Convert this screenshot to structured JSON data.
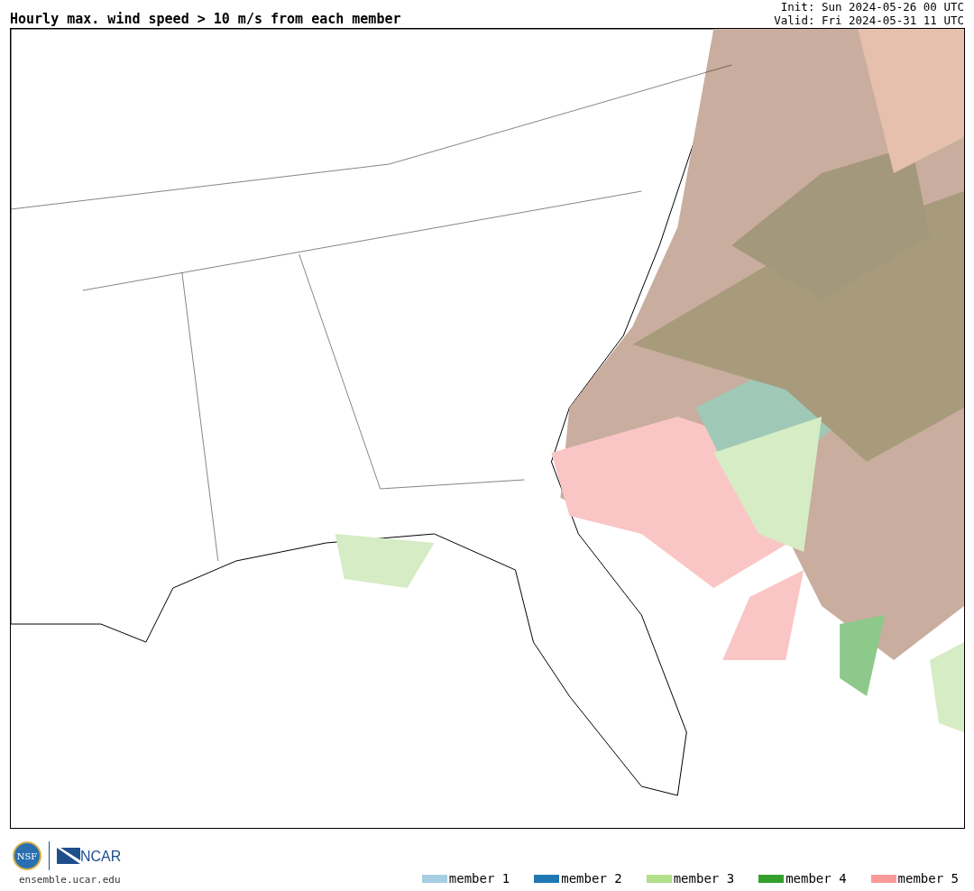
{
  "title": "Hourly max. wind speed > 10 m/s from each member",
  "init": "Init: Sun 2024-05-26 00 UTC",
  "valid": "Valid: Fri 2024-05-31 11 UTC",
  "logos": {
    "nsf": "NSF",
    "ncar": "NCAR"
  },
  "site": "ensemble.ucar.edu",
  "legend": [
    {
      "label": "member 1",
      "color": "#a6cee3"
    },
    {
      "label": "member 2",
      "color": "#1f78b4"
    },
    {
      "label": "member 3",
      "color": "#b2df8a"
    },
    {
      "label": "member 4",
      "color": "#33a02c"
    },
    {
      "label": "member 5",
      "color": "#fb9a99"
    }
  ]
}
